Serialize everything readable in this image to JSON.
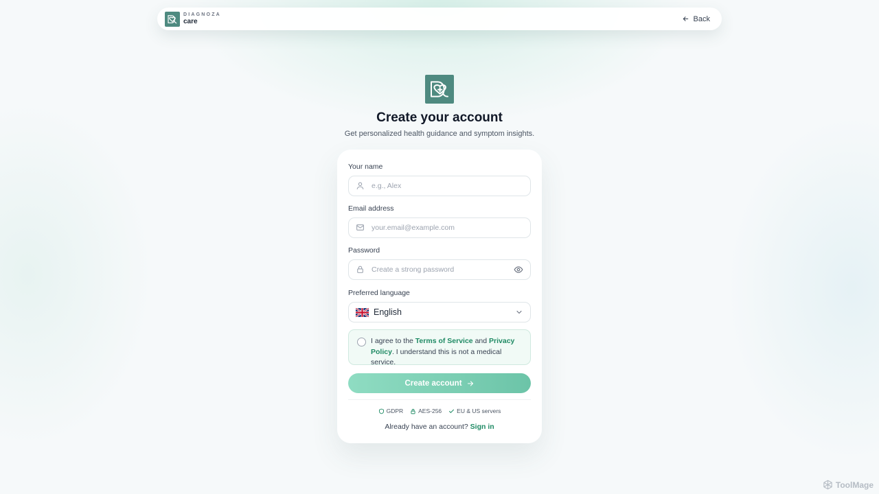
{
  "brand": {
    "top": "DIAGNOZA",
    "bottom": "care"
  },
  "header": {
    "back_label": "Back"
  },
  "hero": {
    "title": "Create your account",
    "subtitle": "Get personalized health guidance and symptom insights."
  },
  "form": {
    "name_label": "Your name",
    "name_placeholder": "e.g., Alex",
    "email_label": "Email address",
    "email_placeholder": "your.email@example.com",
    "password_label": "Password",
    "password_placeholder": "Create a strong password",
    "language_label": "Preferred language",
    "language_value": "English",
    "consent_prefix": "I agree to the ",
    "consent_terms": "Terms of Service",
    "consent_and": " and ",
    "consent_privacy": "Privacy Policy",
    "consent_suffix": ". I understand this is not a medical service.",
    "submit_label": "Create account"
  },
  "trust": {
    "gdpr": "GDPR",
    "aes": "AES-256",
    "servers": "EU & US servers"
  },
  "signin": {
    "prompt": "Already have an account? ",
    "link": "Sign in"
  },
  "watermark": {
    "text": "ToolMage"
  },
  "colors": {
    "brand": "#4e8a80",
    "accent": "#1f8a64",
    "cta_start": "#8fdcc2",
    "cta_end": "#6cc4a8"
  }
}
